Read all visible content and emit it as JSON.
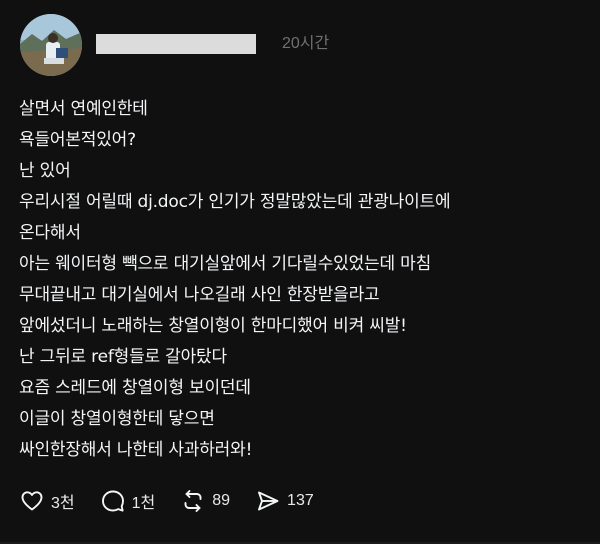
{
  "post": {
    "timestamp": "20시간",
    "lines": [
      "살면서 연예인한테",
      "욕들어본적있어?",
      "난 있어",
      "우리시절 어릴때 dj.doc가 인기가 정말많았는데 관광나이트에",
      "온다해서",
      "아는 웨이터형 빽으로 대기실앞에서 기다릴수있었는데 마침",
      "무대끝내고 대기실에서 나오길래 사인 한장받을라고",
      "앞에섰더니 노래하는 창열이형이 한마디했어 비켜 씨발!",
      "난 그뒤로 ref형들로 갈아탔다",
      "요즘 스레드에 창열이형 보이던데",
      "이글이 창열이형한테 닿으면",
      "싸인한장해서 나한테 사과하러와!"
    ]
  },
  "actions": {
    "like": {
      "icon": "heart-icon",
      "count": "3천"
    },
    "reply": {
      "icon": "comment-icon",
      "count": "1천"
    },
    "repost": {
      "icon": "repost-icon",
      "count": "89"
    },
    "share": {
      "icon": "send-icon",
      "count": "137"
    }
  },
  "colors": {
    "background": "#101010",
    "text": "#f3f5f7",
    "muted": "#6f6f6f",
    "redaction": "#dcdcdc"
  }
}
